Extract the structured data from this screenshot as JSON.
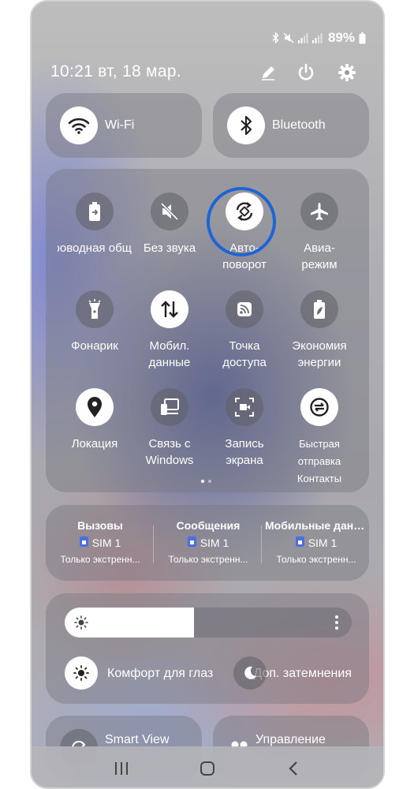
{
  "status_bar": {
    "battery": "89%"
  },
  "header": {
    "datetime": "10:21  вт, 18 мар."
  },
  "quick_pills": [
    {
      "label": "Wi-Fi",
      "icon": "wifi-icon"
    },
    {
      "label": "Bluetooth",
      "icon": "bluetooth-icon"
    }
  ],
  "tiles": [
    {
      "label": "Беспроводная общ.",
      "icon": "battery-share-icon",
      "active": false
    },
    {
      "label": "Без звука",
      "icon": "mute-icon",
      "active": false
    },
    {
      "label": "Авто-\nповорот",
      "icon": "auto-rotate-icon",
      "active": true
    },
    {
      "label": "Авиа-\nрежим",
      "icon": "airplane-icon",
      "active": false
    },
    {
      "label": "Фонарик",
      "icon": "flashlight-icon",
      "active": false
    },
    {
      "label": "Мобил.\nданные",
      "icon": "mobile-data-icon",
      "active": true
    },
    {
      "label": "Точка\nдоступа",
      "icon": "hotspot-icon",
      "active": false
    },
    {
      "label": "Экономия\nэнергии",
      "icon": "power-saving-icon",
      "active": false
    },
    {
      "label": "Локация",
      "icon": "location-icon",
      "active": true
    },
    {
      "label": "Связь с\nWindows",
      "icon": "link-windows-icon",
      "active": false
    },
    {
      "label": "Запись\nэкрана",
      "icon": "screen-record-icon",
      "active": false
    },
    {
      "label": "Быстрая отправка\nКонтакты",
      "icon": "quick-share-icon",
      "active": true
    }
  ],
  "sim_cards": [
    {
      "title": "Вызовы",
      "sim": "SIM 1",
      "status": "Только экстренн..."
    },
    {
      "title": "Сообщения",
      "sim": "SIM 1",
      "status": "Только экстренн..."
    },
    {
      "title": "Мобильные данные",
      "sim": "SIM 1",
      "status": "Только экстренн..."
    }
  ],
  "brightness": {
    "level": 0.45
  },
  "comfort": {
    "eye_label": "Комфорт для глаз",
    "dim_label": "Доп. затемнения"
  },
  "bottom_cards": [
    {
      "label": "Smart View"
    },
    {
      "label": "Управление"
    }
  ],
  "colors": {
    "highlight": "#1e64d4",
    "card": "rgba(120,120,128,0.45)"
  }
}
